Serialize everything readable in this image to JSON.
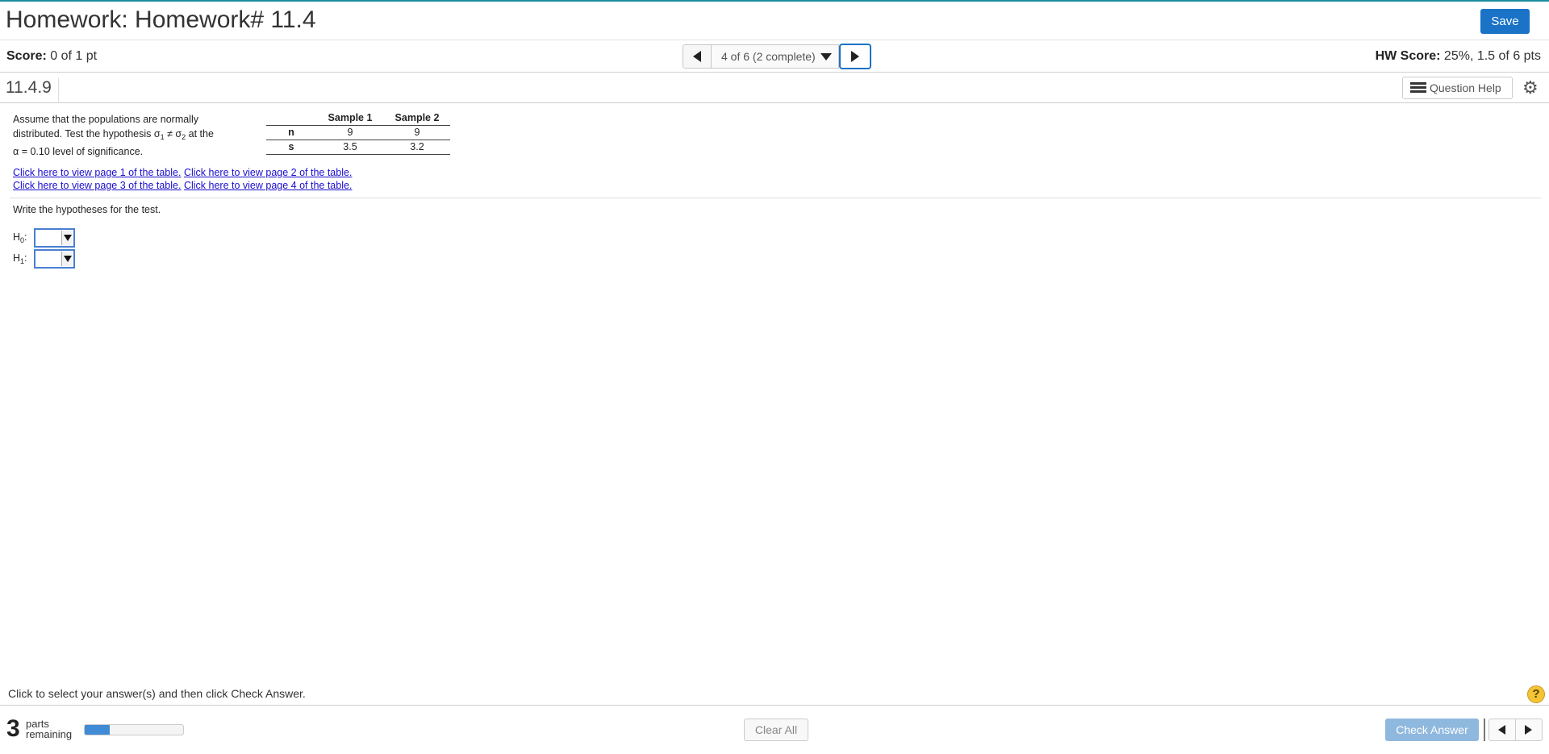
{
  "header": {
    "title": "Homework: Homework# 11.4",
    "save_label": "Save"
  },
  "scorebar": {
    "score_label": "Score:",
    "score_value": "0 of 1 pt",
    "nav_position": "4 of 6 (2 complete)",
    "hw_score_label": "HW Score:",
    "hw_score_value": "25%, 1.5 of 6 pts"
  },
  "question": {
    "number": "11.4.9",
    "help_label": "Question Help",
    "text_line1": "Assume that the populations are normally",
    "text_line2_a": "distributed. Test the hypothesis σ",
    "text_line2_sub1": "1",
    "text_line2_b": " ≠ σ",
    "text_line2_sub2": "2",
    "text_line2_c": " at the",
    "text_line3": "α = 0.10 level of significance.",
    "table": {
      "headers": [
        "",
        "Sample 1",
        "Sample 2"
      ],
      "rows": [
        [
          "n",
          "9",
          "9"
        ],
        [
          "s",
          "3.5",
          "3.2"
        ]
      ]
    },
    "links": [
      "Click here to view page 1 of the table.",
      "Click here to view page 2 of the table.",
      "Click here to view page 3 of the table.",
      "Click here to view page 4 of the table."
    ],
    "prompt": "Write the hypotheses for the test.",
    "h0_label": "H",
    "h0_sub": "0",
    "h1_label": "H",
    "h1_sub": "1",
    "colon": ":"
  },
  "footer": {
    "instruction": "Click to select your answer(s) and then click Check Answer.",
    "help_glyph": "?",
    "parts_count": "3",
    "parts_word": "parts",
    "remaining_word": "remaining",
    "progress_fraction": 0.25,
    "clear_label": "Clear All",
    "check_label": "Check Answer"
  },
  "colors": {
    "accent": "#1a73c7",
    "link": "#1a0dcc",
    "progress": "#3f8bd6",
    "help_badge": "#f5c433"
  }
}
